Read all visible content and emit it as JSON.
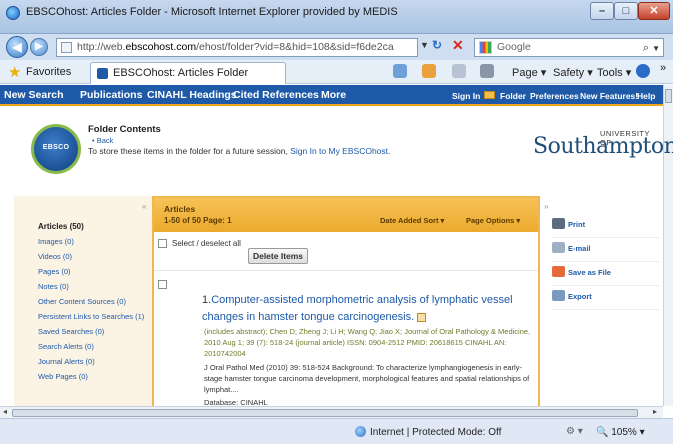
{
  "window": {
    "title": "EBSCOhost: Articles Folder - Microsoft Internet Explorer provided by MEDIS",
    "min_glyph": "–",
    "max_glyph": "□",
    "close_glyph": "✕"
  },
  "address_bar": {
    "url_prefix": "http://web.",
    "url_domain": "ebscohost.com",
    "url_rest": "/ehost/folder?vid=8&hid=108&sid=f6de2ca",
    "search_placeholder": "Google"
  },
  "favorites_bar": {
    "favorites_label": "Favorites",
    "tab_title": "EBSCOhost: Articles Folder",
    "commands": {
      "page": "Page ▾",
      "safety": "Safety ▾",
      "tools": "Tools ▾",
      "more": "»"
    }
  },
  "ebsco_nav": {
    "items": [
      "New Search",
      "Publications",
      "CINAHL Headings",
      "Cited References",
      "More"
    ],
    "right_items": [
      "Sign In",
      "Folder",
      "Preferences",
      "New Features!",
      "Help"
    ]
  },
  "header": {
    "logo_text": "EBSCO",
    "folder_title": "Folder Contents",
    "back_link": "• Back",
    "desc_before": "To store these items in the folder for a future session, ",
    "desc_link": "Sign In to My EBSCOhost",
    "desc_after": ".",
    "university_top": "UNIVERSITY OF",
    "university_name": "Southampton"
  },
  "sidebar": {
    "collapse_glyph": "«",
    "items": [
      "Articles (50)",
      "Images (0)",
      "Videos (0)",
      "Pages (0)",
      "Notes (0)",
      "Other Content Sources (0)",
      "Persistent Links to Searches (1)",
      "Saved Searches (0)",
      "Search Alerts (0)",
      "Journal Alerts (0)",
      "Web Pages (0)"
    ]
  },
  "results": {
    "heading": "Articles",
    "range": "1-50 of 50",
    "page_label": "Page: 1",
    "sort_label": "Date Added Sort ▾",
    "options_label": "Page Options ▾",
    "select_all": "Select / deselect all",
    "delete_button": "Delete Items",
    "record": {
      "number": "1.",
      "title": "Computer-assisted morphometric analysis of lymphatic vessel changes in hamster tongue carcinogenesis.",
      "citation": "(includes abstract); Chen D; Zheng J; Li H; Wang Q; Jiao X; Journal of Oral Pathology & Medicine, 2010 Aug 1; 39 (7): 518-24 (journal article) ISSN: 0904-2512 PMID: 20618615 CINAHL AN: 2010742004",
      "abstract": "J Oral Pathol Med (2010) 39: 518-524 Background: To characterize lymphangiogenesis in early-stage hamster tongue carcinoma development, morphological features and spatial relationships of lymphat....",
      "database": "Database: CINAHL"
    }
  },
  "tools": {
    "collapse_glyph": "»",
    "items": [
      "Print",
      "E-mail",
      "Save as File",
      "Export"
    ]
  },
  "statusbar": {
    "zone": "Internet | Protected Mode: Off",
    "zoom": "105%",
    "security_glyph": "⚙ ▾"
  }
}
